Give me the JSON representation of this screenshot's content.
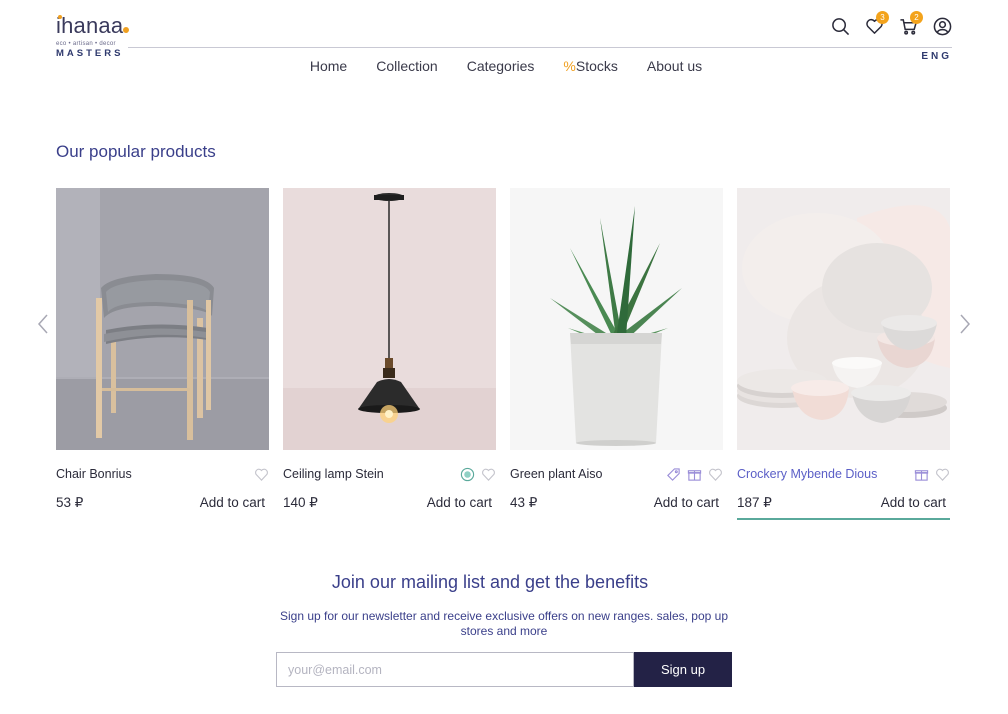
{
  "brand": {
    "name": "ihanaa",
    "tagline": "eco • artisan • decor",
    "sub": "MASTERS",
    "accent": "#f0a020",
    "primary": "#2f3a6e"
  },
  "header": {
    "icons": [
      "search-icon",
      "heart-icon",
      "cart-icon",
      "user-icon"
    ],
    "wishlist_count": "3",
    "cart_count": "2",
    "lang": "ENG"
  },
  "nav": {
    "items": [
      {
        "label": "Home"
      },
      {
        "label": "Collection"
      },
      {
        "label": "Categories"
      },
      {
        "prefix": "%",
        "label": "Stocks"
      },
      {
        "label": "About us"
      }
    ]
  },
  "popular": {
    "title": "Our popular products",
    "add_label": "Add to cart",
    "products": [
      {
        "name": "Chair Bonrius",
        "price": "53 ₽",
        "badges": [
          "heart-icon"
        ]
      },
      {
        "name": "Ceiling lamp Stein",
        "price": "140 ₽",
        "badges": [
          "eco-icon",
          "heart-icon"
        ]
      },
      {
        "name": "Green plant Aiso",
        "price": "43 ₽",
        "badges": [
          "tag-icon",
          "gift-icon",
          "heart-icon"
        ]
      },
      {
        "name": "Crockery Mybende Dious",
        "price": "187 ₽",
        "badges": [
          "gift-icon",
          "heart-icon"
        ],
        "highlight_color": "#5b5fc7",
        "underline_color": "#5aa99b"
      }
    ]
  },
  "newsletter": {
    "title": "Join our mailing list and get the benefits",
    "description": "Sign up for our newsletter and receive exclusive offers on new ranges. sales, pop up stores and more",
    "placeholder": "your@email.com",
    "button": "Sign up",
    "button_color": "#232246"
  }
}
